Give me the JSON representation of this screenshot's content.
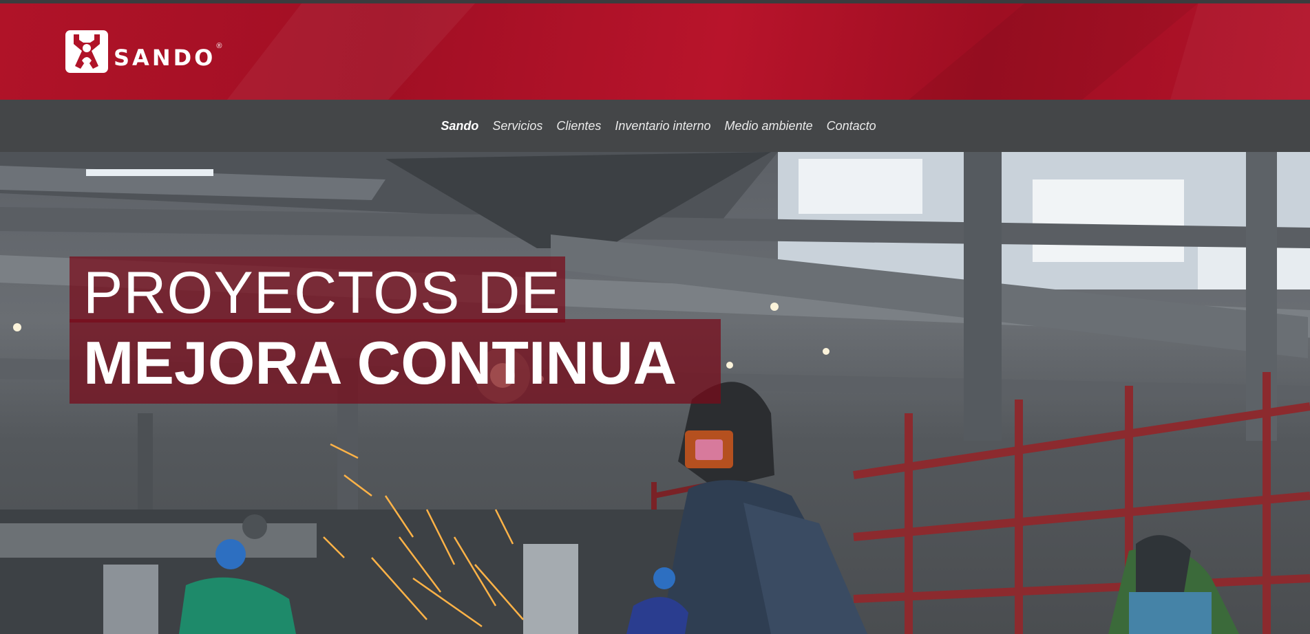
{
  "brand": {
    "name": "SANDO",
    "registered_mark": "®",
    "logo_icon": "sando-figure-icon",
    "header_color": "#b01328"
  },
  "nav": {
    "items": [
      {
        "label": "Sando",
        "active": true
      },
      {
        "label": "Servicios",
        "active": false
      },
      {
        "label": "Clientes",
        "active": false
      },
      {
        "label": "Inventario interno",
        "active": false
      },
      {
        "label": "Medio ambiente",
        "active": false
      },
      {
        "label": "Contacto",
        "active": false
      }
    ]
  },
  "hero": {
    "line1": "PROYECTOS DE",
    "line2": "MEJORA CONTINUA",
    "overlay_color": "#780a19"
  }
}
